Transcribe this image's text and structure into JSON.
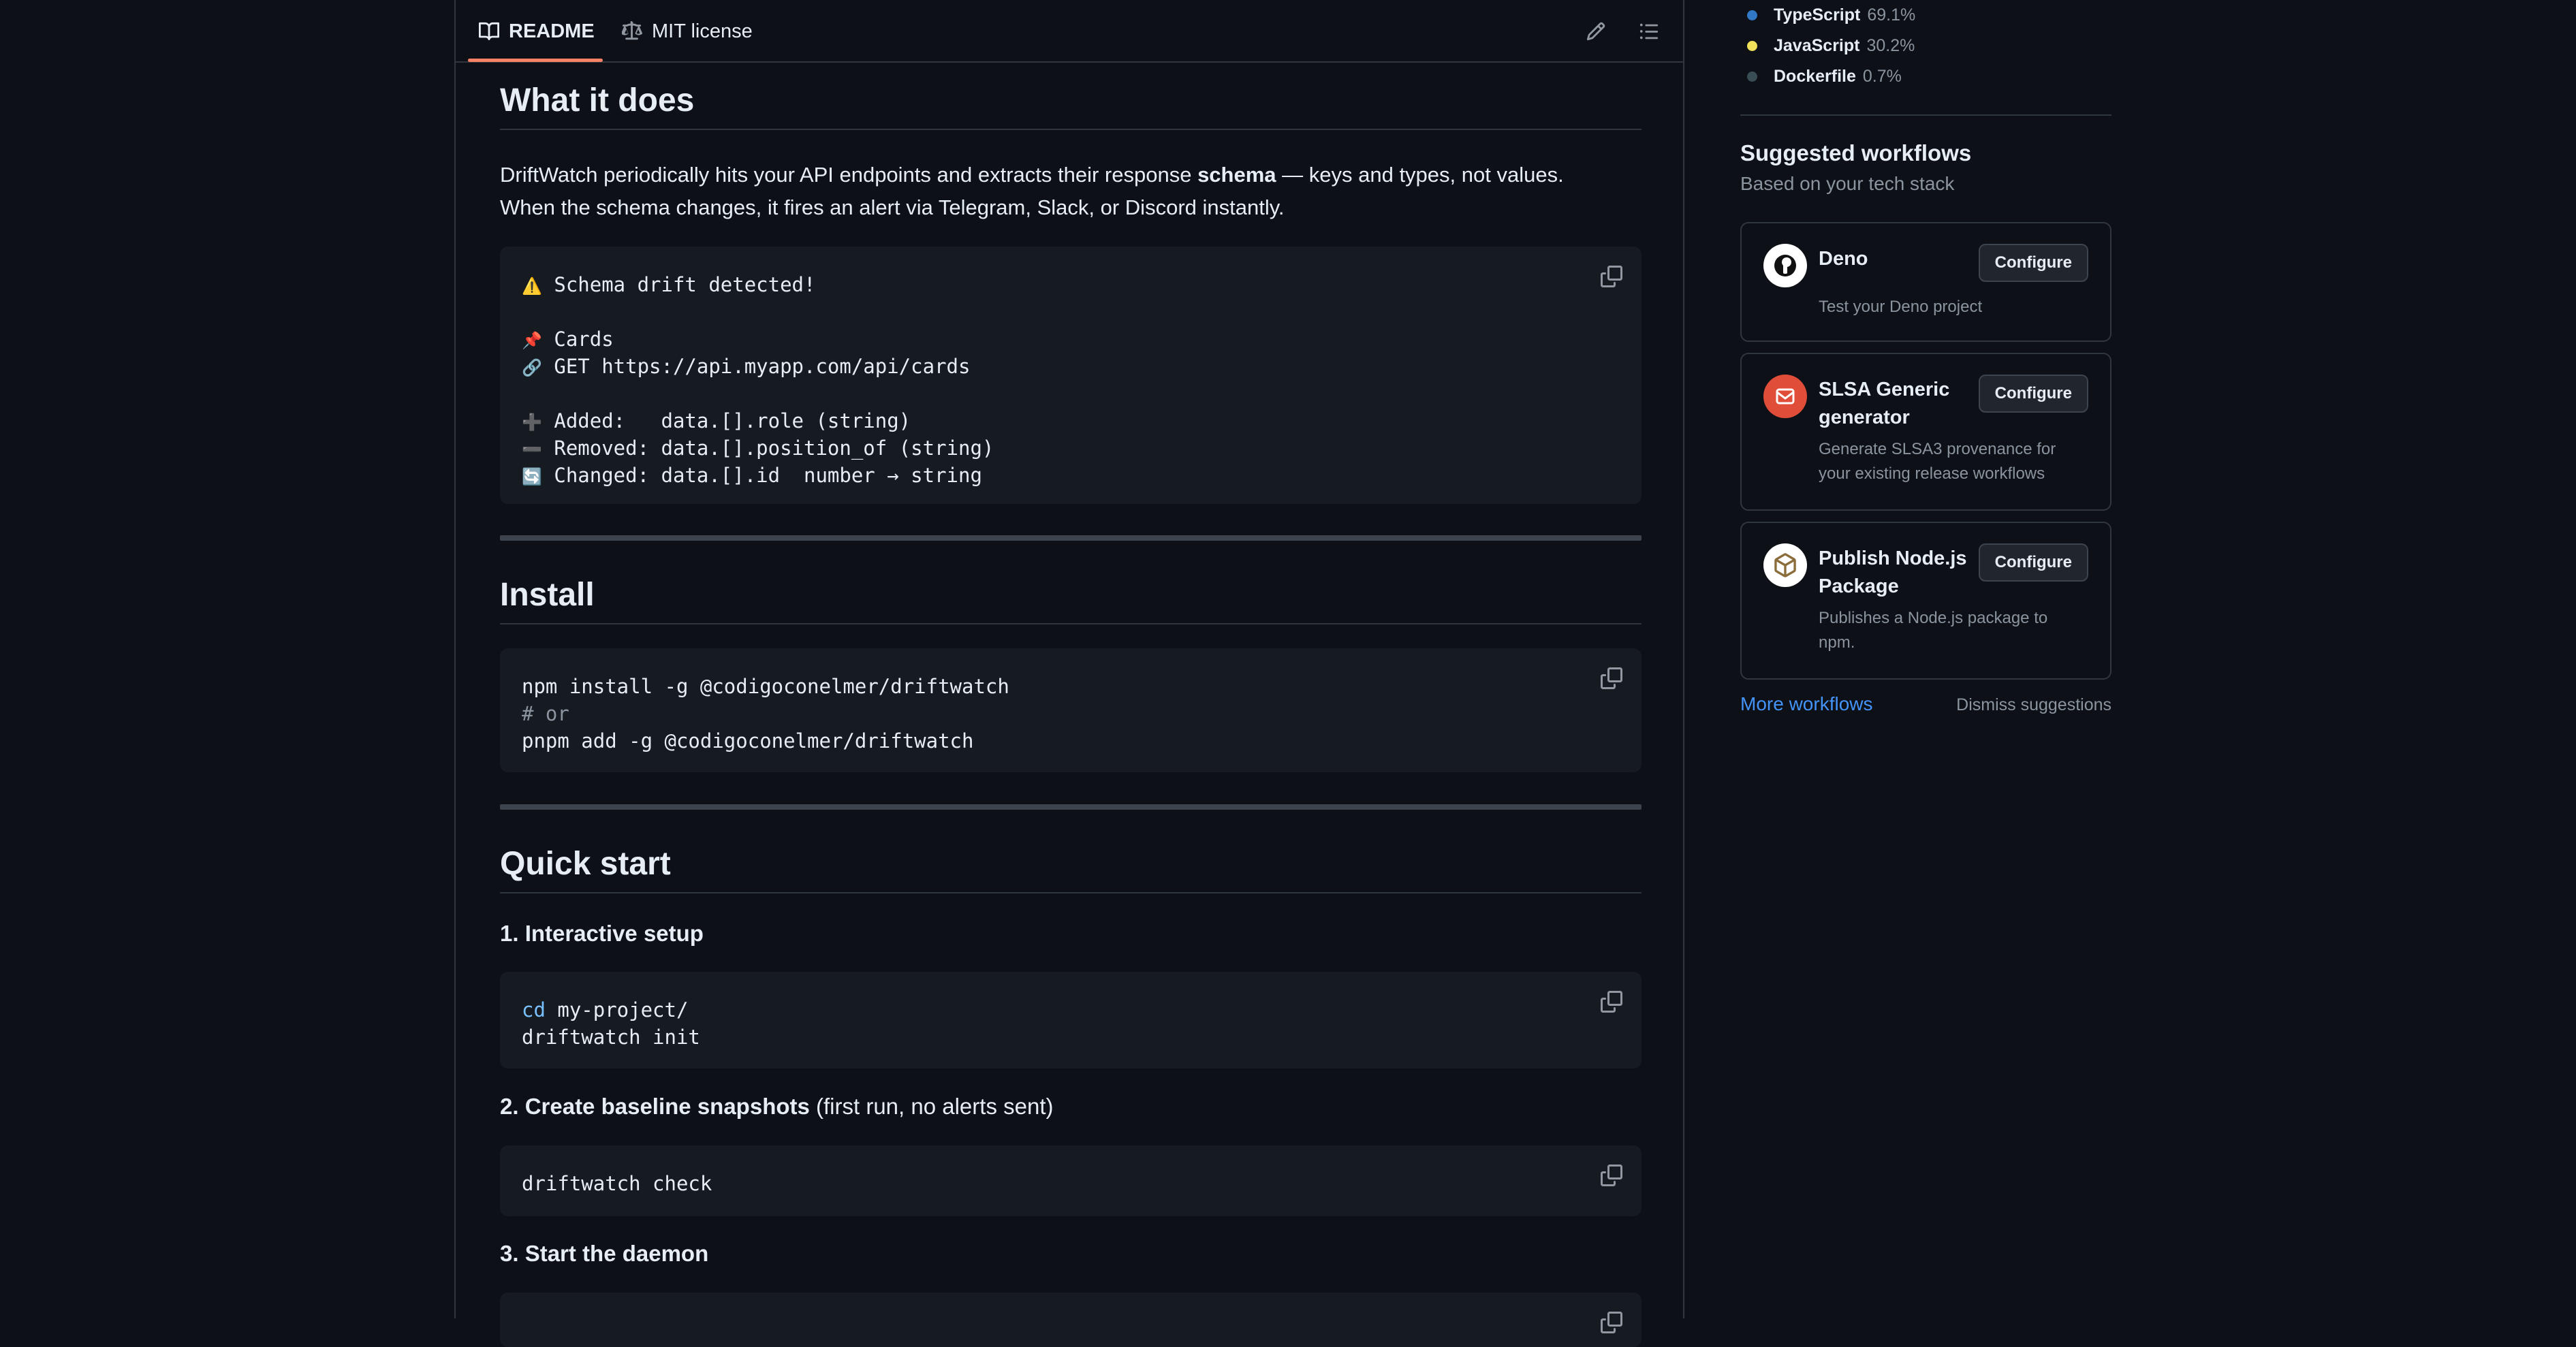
{
  "readme": {
    "tabs": {
      "readme": "README",
      "license": "MIT license"
    },
    "sections": {
      "what": {
        "title": "What it does",
        "p_line1_a": "DriftWatch periodically hits your API endpoints and extracts their response ",
        "p_line1_bold": "schema",
        "p_line1_b": " — keys and types, not values.",
        "p_line2": "When the schema changes, it fires an alert via Telegram, Slack, or Discord instantly.",
        "code": {
          "l1_emoji": "⚠️",
          "l1": "Schema drift detected!",
          "l3_emoji": "📌",
          "l3": "Cards",
          "l4_emoji": "🔗",
          "l4": "GET https://api.myapp.com/api/cards",
          "l6_emoji": "➕",
          "l6": "Added:   data.[].role (string)",
          "l7_emoji": "➖",
          "l7": "Removed: data.[].position_of (string)",
          "l8_emoji": "🔄",
          "l8": "Changed: data.[].id  number → string"
        }
      },
      "install": {
        "title": "Install",
        "code": {
          "l1": "npm install -g @codigoconelmer/driftwatch",
          "l2": "# or",
          "l3": "pnpm add -g @codigoconelmer/driftwatch"
        }
      },
      "quickstart": {
        "title": "Quick start",
        "step1": {
          "title": "1. Interactive setup",
          "code_kw": "cd",
          "code_l1_rest": " my-project/",
          "code_l2": "driftwatch init"
        },
        "step2": {
          "title": "2. Create baseline snapshots",
          "note": " (first run, no alerts sent)",
          "code": "driftwatch check"
        },
        "step3": {
          "title": "3. Start the daemon"
        }
      }
    }
  },
  "sidebar": {
    "languages": [
      {
        "name": "TypeScript",
        "pct": "69.1%",
        "color": "#3178c6"
      },
      {
        "name": "JavaScript",
        "pct": "30.2%",
        "color": "#f1e05a"
      },
      {
        "name": "Dockerfile",
        "pct": "0.7%",
        "color": "#384d54"
      }
    ],
    "workflows": {
      "title": "Suggested workflows",
      "subtitle": "Based on your tech stack",
      "items": [
        {
          "name": "Deno",
          "desc_l1": "Test your Deno project",
          "desc_l2": "",
          "button": "Configure",
          "icon": "deno-icon"
        },
        {
          "name_l1": "SLSA Generic",
          "name_l2": "generator",
          "desc_l1": "Generate SLSA3 provenance for",
          "desc_l2": "your existing release workflows",
          "button": "Configure",
          "icon": "slsa-icon"
        },
        {
          "name_l1": "Publish Node.js",
          "name_l2": "Package",
          "desc_l1": "Publishes a Node.js package to",
          "desc_l2": "npm.",
          "button": "Configure",
          "icon": "package-icon"
        }
      ],
      "more": "More workflows",
      "dismiss": "Dismiss suggestions"
    }
  }
}
